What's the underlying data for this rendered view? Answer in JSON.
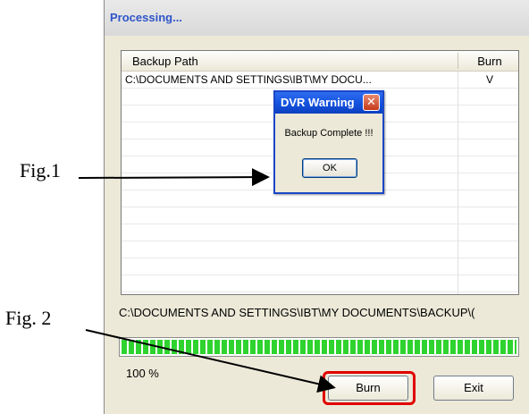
{
  "annotations": {
    "fig1_label": "Fig.1",
    "fig2_label": "Fig. 2"
  },
  "window": {
    "title": "Processing...",
    "list": {
      "columns": [
        "Backup Path",
        "Burn"
      ],
      "rows": [
        {
          "path": "C:\\DOCUMENTS AND SETTINGS\\IBT\\MY DOCU...",
          "burn": "V"
        }
      ]
    },
    "status_path": "C:\\DOCUMENTS AND SETTINGS\\IBT\\MY DOCUMENTS\\BACKUP\\(",
    "progress": {
      "percent_value": 100,
      "label": "100  %"
    },
    "buttons": {
      "burn": "Burn",
      "exit": "Exit"
    }
  },
  "dialog": {
    "title": "DVR Warning",
    "close_glyph": "✕",
    "message": "Backup Complete !!!",
    "ok_label": "OK"
  },
  "colors": {
    "title_text": "#2f55c9",
    "dialog_title": "#1554e0",
    "progress_fill": "#2fd32f",
    "highlight": "#e00000"
  }
}
